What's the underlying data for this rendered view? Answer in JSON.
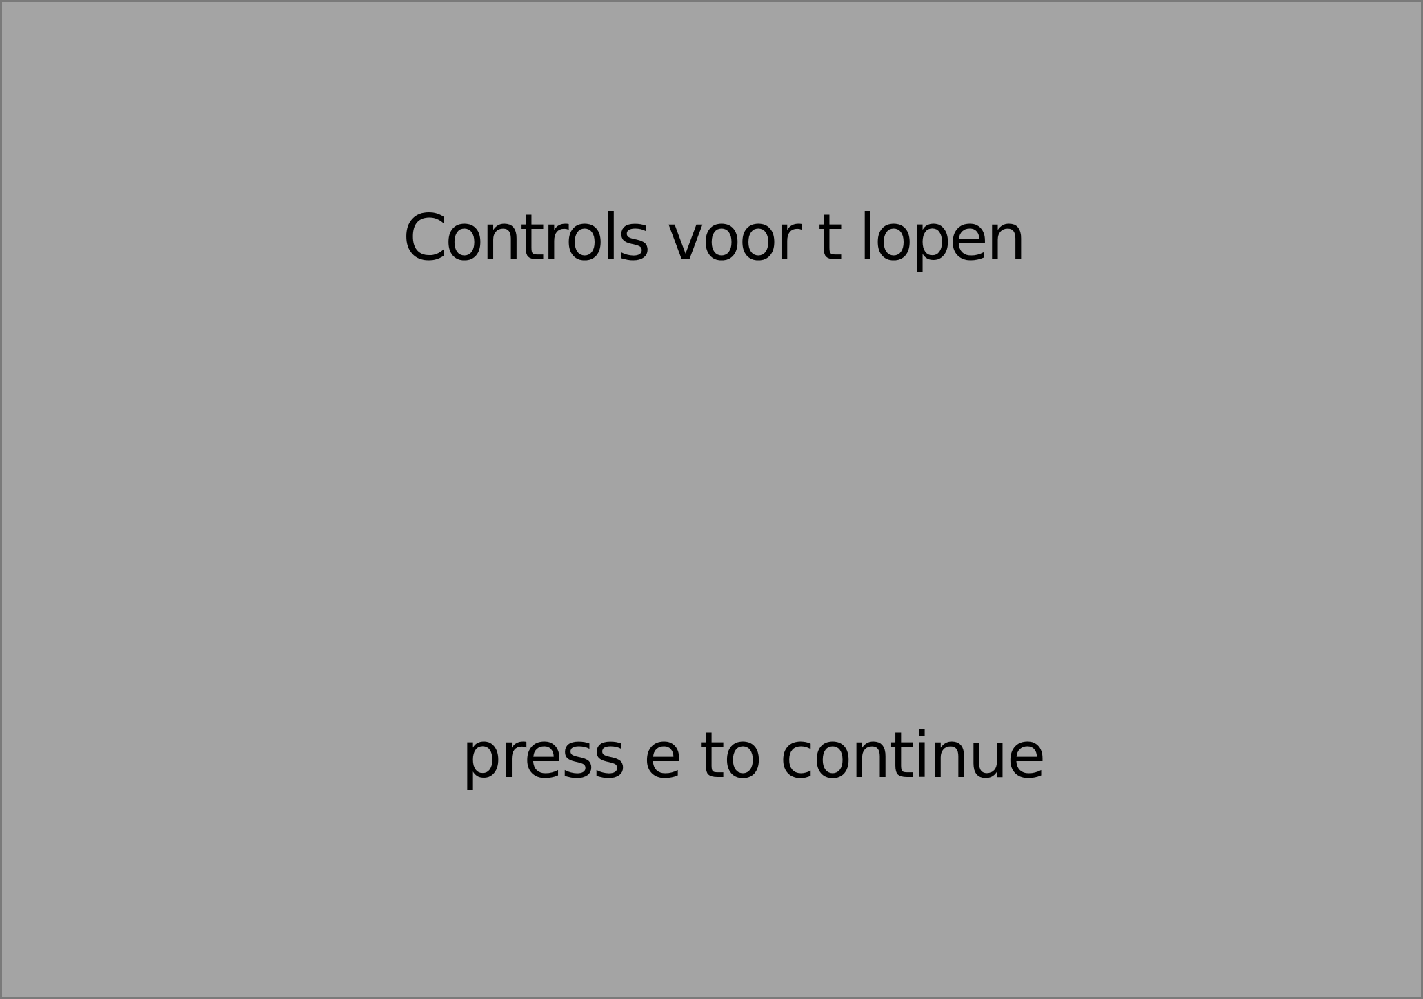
{
  "screen": {
    "title": "Controls voor t lopen",
    "prompt": "press e to continue",
    "colors": {
      "background": "#a4a4a4",
      "border": "#7a7a7a",
      "text": "#000000"
    }
  }
}
